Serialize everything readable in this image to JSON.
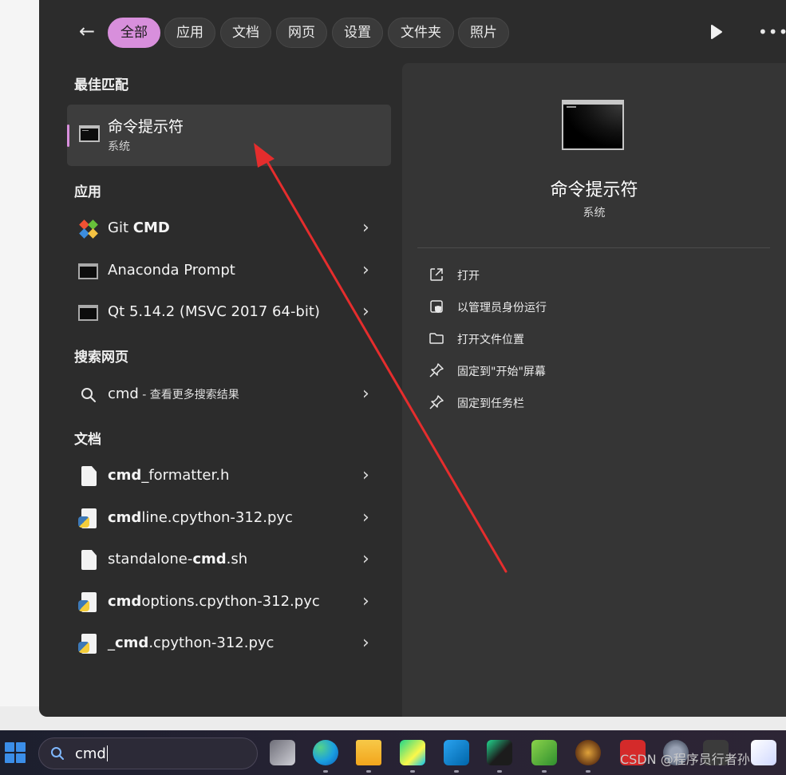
{
  "filters": {
    "back_label": "←",
    "tabs": [
      {
        "label": "全部",
        "active": true
      },
      {
        "label": "应用",
        "active": false
      },
      {
        "label": "文档",
        "active": false
      },
      {
        "label": "网页",
        "active": false
      },
      {
        "label": "设置",
        "active": false
      },
      {
        "label": "文件夹",
        "active": false
      },
      {
        "label": "照片",
        "active": false
      }
    ],
    "more_label": "•••",
    "accent_color": "#d88fdc"
  },
  "results": {
    "best_match": {
      "heading": "最佳匹配",
      "title": "命令提示符",
      "subtitle": "系统",
      "icon": "command-prompt-icon"
    },
    "apps": {
      "heading": "应用",
      "items": [
        {
          "pre": "Git ",
          "bold": "CMD",
          "post": "",
          "icon": "git-icon"
        },
        {
          "pre": "Anaconda Prompt",
          "bold": "",
          "post": "",
          "icon": "terminal-icon"
        },
        {
          "pre": "Qt 5.14.2 (MSVC 2017 64-bit)",
          "bold": "",
          "post": "",
          "icon": "terminal-icon"
        }
      ]
    },
    "web": {
      "heading": "搜索网页",
      "query": "cmd",
      "suffix": " - 查看更多搜索结果"
    },
    "documents": {
      "heading": "文档",
      "items": [
        {
          "pre": "",
          "bold": "cmd",
          "post": "_formatter.h",
          "icon": "document-icon"
        },
        {
          "pre": "",
          "bold": "cmd",
          "post": "line.cpython-312.pyc",
          "icon": "python-file-icon"
        },
        {
          "pre": "standalone-",
          "bold": "cmd",
          "post": ".sh",
          "icon": "document-icon"
        },
        {
          "pre": "",
          "bold": "cmd",
          "post": "options.cpython-312.pyc",
          "icon": "python-file-icon"
        },
        {
          "pre": "_",
          "bold": "cmd",
          "post": ".cpython-312.pyc",
          "icon": "python-file-icon"
        }
      ]
    }
  },
  "detail": {
    "title": "命令提示符",
    "subtitle": "系统",
    "actions": [
      {
        "label": "打开",
        "icon": "open-external-icon"
      },
      {
        "label": "以管理员身份运行",
        "icon": "shield-admin-icon"
      },
      {
        "label": "打开文件位置",
        "icon": "folder-icon"
      },
      {
        "label": "固定到\"开始\"屏幕",
        "icon": "pin-icon"
      },
      {
        "label": "固定到任务栏",
        "icon": "pin-icon"
      }
    ]
  },
  "taskbar": {
    "search_text": "cmd",
    "apps": [
      "task-view-icon",
      "edge-icon",
      "file-explorer-icon",
      "pycharm-icon",
      "vscode-icon",
      "clion-icon",
      "app-icon",
      "game-icon",
      "wps-icon",
      "settings-icon",
      "wechat-icon",
      "store-icon"
    ]
  },
  "watermark": "CSDN @程序员行者孙"
}
